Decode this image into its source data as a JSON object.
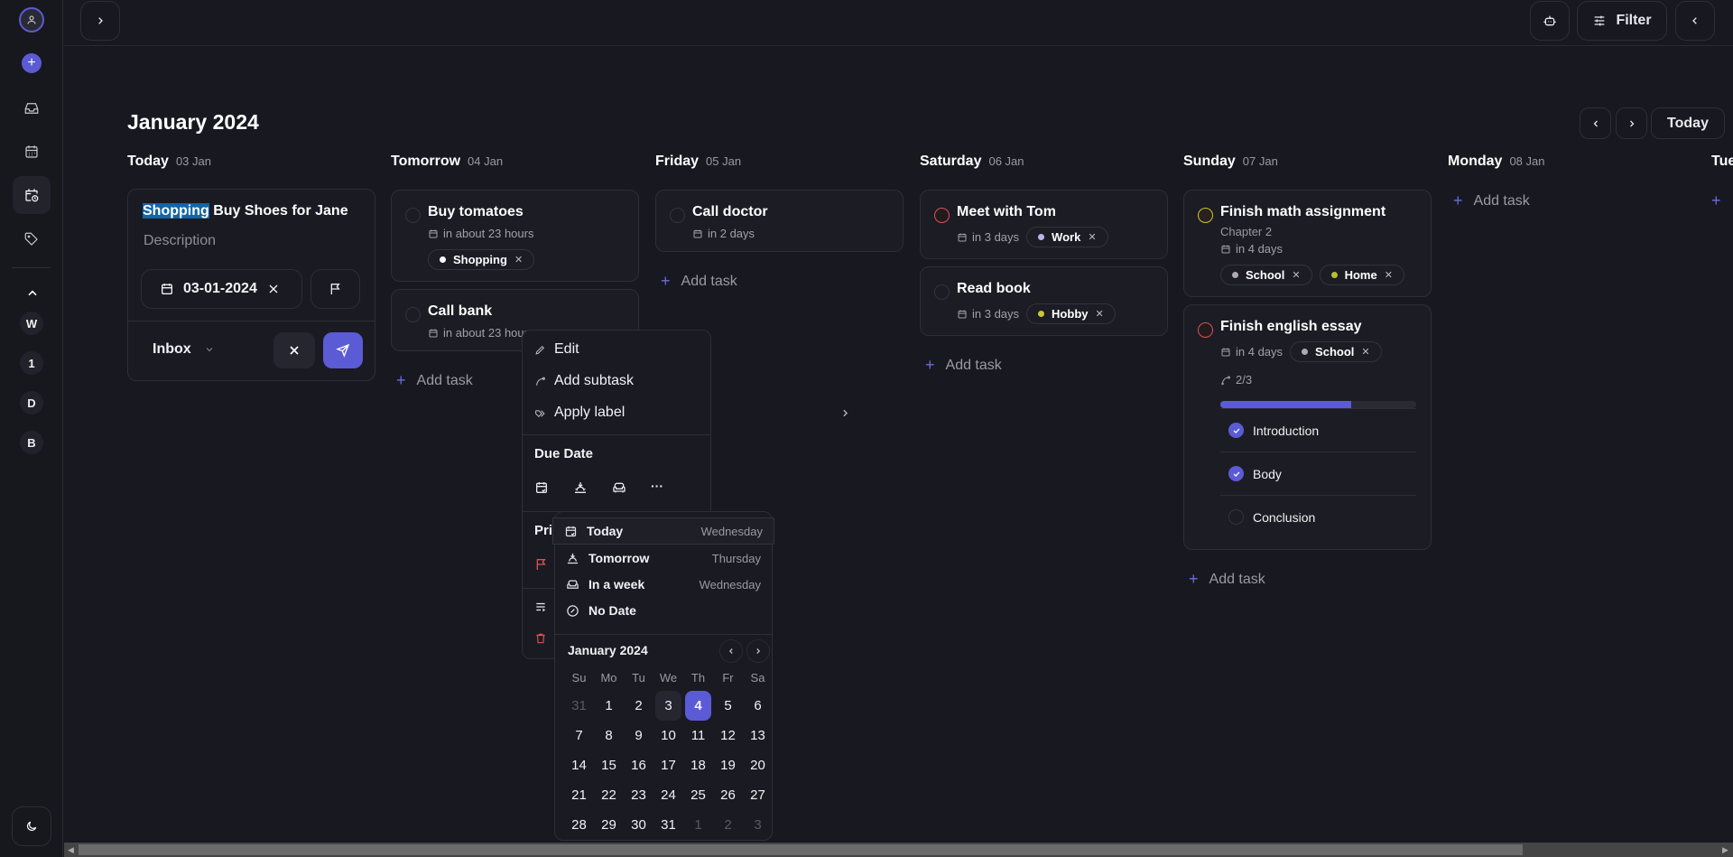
{
  "sidebar": {
    "icons": [
      "user-icon",
      "plus-icon",
      "inbox-icon",
      "calendar-icon",
      "upcoming-icon",
      "tag-icon"
    ],
    "projects": [
      "W",
      "1",
      "D",
      "B"
    ],
    "theme_icon": "moon-icon"
  },
  "topbar": {
    "filter_label": "Filter"
  },
  "header": {
    "month_title": "January 2024",
    "today_label": "Today"
  },
  "editing_task": {
    "title_highlight": "Shopping",
    "title_rest": " Buy Shoes for Jane",
    "description_placeholder": "Description",
    "date_value": "03-01-2024",
    "project": "Inbox"
  },
  "add_task_label": "Add task",
  "columns": [
    {
      "day": "Today",
      "date": "03 Jan",
      "tasks": []
    },
    {
      "day": "Tomorrow",
      "date": "04 Jan",
      "tasks": [
        {
          "title": "Buy tomatoes",
          "due": "in about 23 hours",
          "priority": "none",
          "tags": [
            {
              "name": "Shopping",
              "color": "#ffffff"
            }
          ]
        },
        {
          "title": "Call bank",
          "due": "in about 23 hours",
          "priority": "none",
          "tags": []
        }
      ]
    },
    {
      "day": "Friday",
      "date": "05 Jan",
      "tasks": [
        {
          "title": "Call doctor",
          "due": "in 2 days",
          "priority": "none",
          "tags": []
        }
      ]
    },
    {
      "day": "Saturday",
      "date": "06 Jan",
      "tasks": [
        {
          "title": "Meet with Tom",
          "due": "in 3 days",
          "priority": "high",
          "tags": [
            {
              "name": "Work",
              "color": "#b8b8e8"
            }
          ]
        },
        {
          "title": "Read book",
          "due": "in 3 days",
          "priority": "none",
          "tags": [
            {
              "name": "Hobby",
              "color": "#c8c830"
            }
          ]
        }
      ]
    },
    {
      "day": "Sunday",
      "date": "07 Jan",
      "tasks": [
        {
          "title": "Finish math assignment",
          "description": "Chapter 2",
          "due": "in 4 days",
          "priority": "medium",
          "tags": [
            {
              "name": "School",
              "color": "#b0a8b8"
            },
            {
              "name": "Home",
              "color": "#b8c030"
            }
          ]
        },
        {
          "title": "Finish english essay",
          "due": "in 4 days",
          "priority": "high",
          "tags": [
            {
              "name": "School",
              "color": "#b0a8b8"
            }
          ],
          "subtask_count": "2/3",
          "subtask_progress": 0.667,
          "subtasks": [
            {
              "title": "Introduction",
              "done": true
            },
            {
              "title": "Body",
              "done": true
            },
            {
              "title": "Conclusion",
              "done": false
            }
          ]
        }
      ]
    },
    {
      "day": "Monday",
      "date": "08 Jan",
      "tasks": []
    },
    {
      "day": "Tue",
      "date": "",
      "tasks": []
    }
  ],
  "context_menu": {
    "edit": "Edit",
    "add_subtask": "Add subtask",
    "apply_label": "Apply label",
    "due_date_heading": "Due Date",
    "priority_heading": "Pri"
  },
  "date_popup": {
    "options": [
      {
        "label": "Today",
        "day": "Wednesday",
        "icon": "calendar-check-icon"
      },
      {
        "label": "Tomorrow",
        "day": "Thursday",
        "icon": "sunrise-icon"
      },
      {
        "label": "In a week",
        "day": "Wednesday",
        "icon": "couch-icon"
      },
      {
        "label": "No Date",
        "day": "",
        "icon": "no-date-icon"
      }
    ],
    "month": "January 2024",
    "weekdays": [
      "Su",
      "Mo",
      "Tu",
      "We",
      "Th",
      "Fr",
      "Sa"
    ],
    "days": [
      [
        "31",
        "1",
        "2",
        "3",
        "4",
        "5",
        "6"
      ],
      [
        "7",
        "8",
        "9",
        "10",
        "11",
        "12",
        "13"
      ],
      [
        "14",
        "15",
        "16",
        "17",
        "18",
        "19",
        "20"
      ],
      [
        "21",
        "22",
        "23",
        "24",
        "25",
        "26",
        "27"
      ],
      [
        "28",
        "29",
        "30",
        "31",
        "1",
        "2",
        "3"
      ]
    ],
    "today": "3",
    "selected": "4"
  },
  "colors": {
    "accent": "#5b5bd6",
    "background": "#181820",
    "priority_high": "#d9534f",
    "priority_medium": "#c9c62a"
  }
}
